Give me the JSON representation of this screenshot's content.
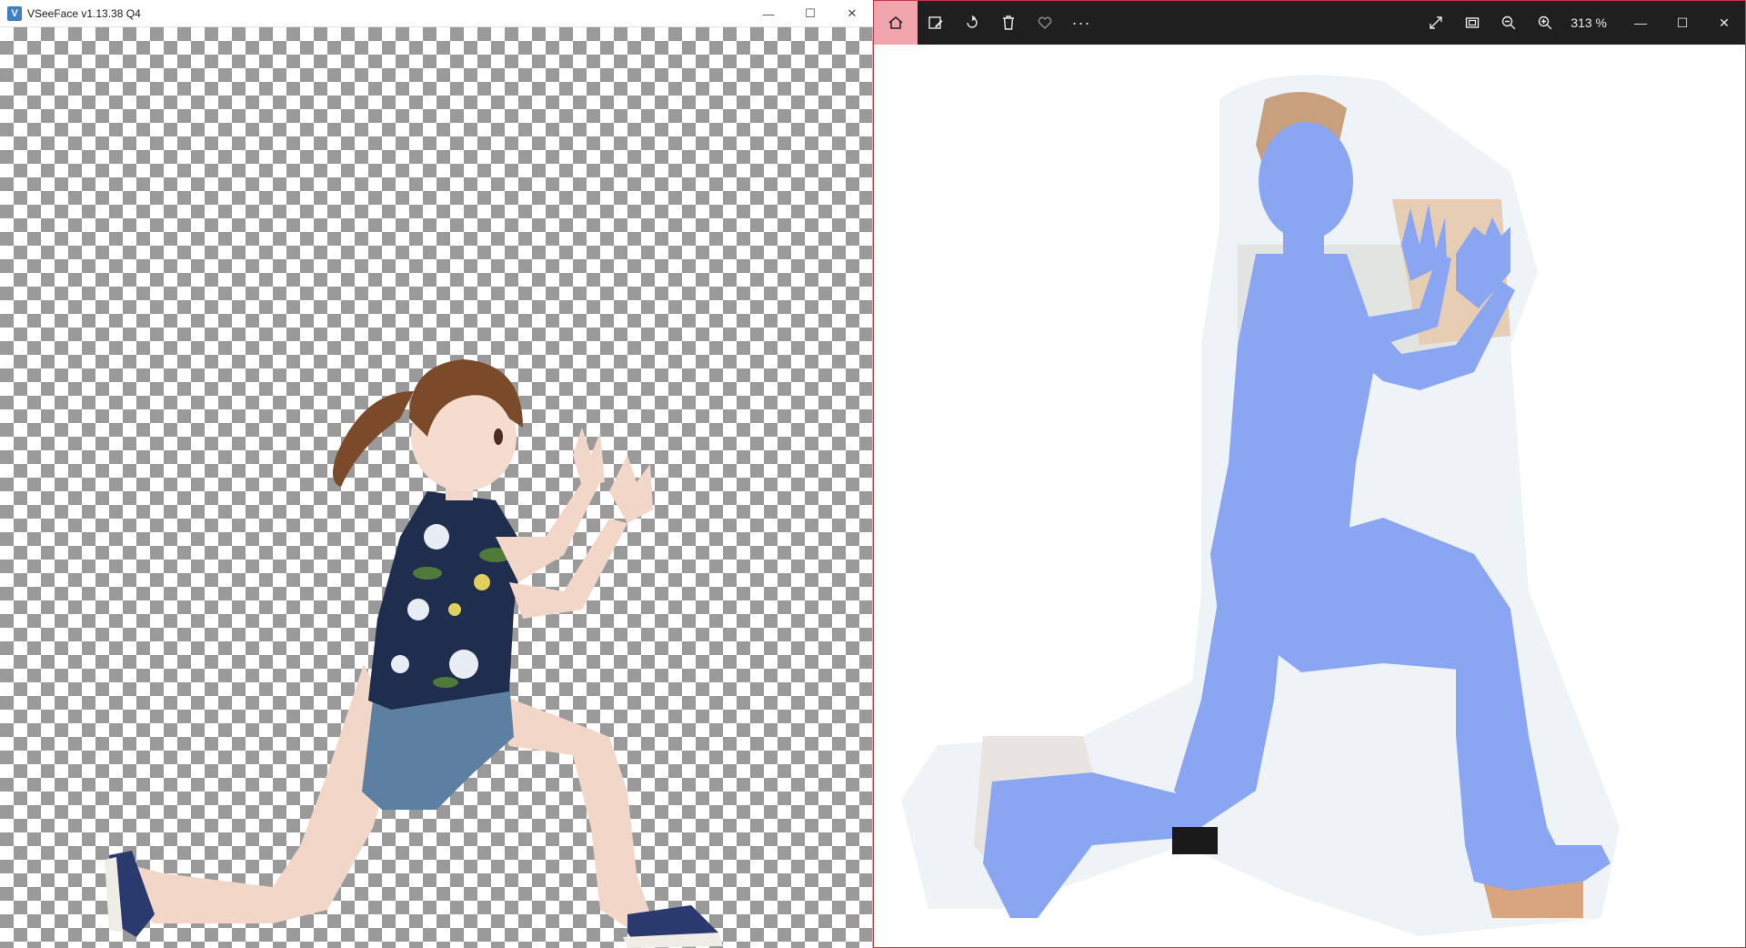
{
  "left_window": {
    "app_icon": "V",
    "title": "VSeeFace v1.13.38 Q4",
    "controls": {
      "minimize": "—",
      "maximize": "☐",
      "close": "✕"
    }
  },
  "right_window": {
    "toolbar": {
      "icons": [
        "home-icon",
        "edit-image-icon",
        "rotate-icon",
        "delete-icon",
        "favorite-icon",
        "more-options-icon"
      ],
      "more": "···",
      "view_icons": [
        "fullscreen-icon",
        "fit-window-icon",
        "zoom-out-icon",
        "zoom-in-icon"
      ],
      "zoom_level": "313 %",
      "controls": {
        "minimize": "—",
        "maximize": "☐",
        "close": "✕"
      }
    }
  },
  "colors": {
    "mesh_blue": "#8aa6f2",
    "checker_dark": "#9a9a9a",
    "checker_light": "#ffffff",
    "accent_pink": "#f2a4ad",
    "photos_toolbar": "#1f1f1f"
  }
}
